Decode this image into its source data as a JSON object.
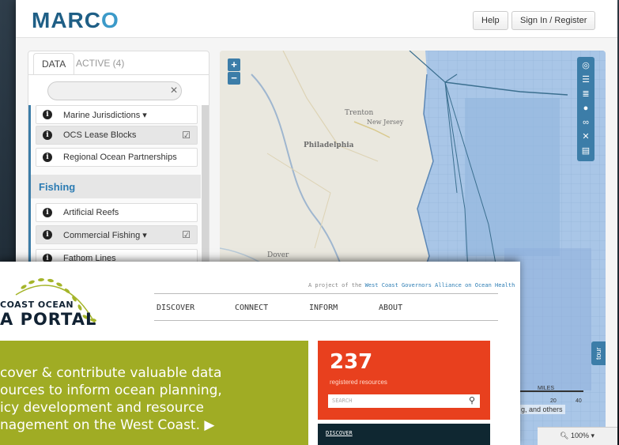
{
  "marco": {
    "logo": "MARC",
    "logo_o": "O",
    "help_label": "Help",
    "signin_label": "Sign In / Register",
    "tabs": [
      "DATA",
      "ACTIVE (4)"
    ],
    "search_clear": "×",
    "layers_top": [
      {
        "label": "Marine Jurisdictions ▾",
        "checked": false
      },
      {
        "label": "OCS Lease Blocks",
        "checked": true
      },
      {
        "label": "Regional Ocean Partnerships",
        "checked": false
      }
    ],
    "section": "Fishing",
    "layers_fishing": [
      {
        "label": "Artificial Reefs",
        "checked": false
      },
      {
        "label": "Commercial Fishing ▾",
        "checked": true
      },
      {
        "label": "Fathom Lines",
        "checked": false
      }
    ],
    "map": {
      "zoom_in": "+",
      "zoom_out": "−",
      "labels": [
        "Trenton",
        "New Jersey",
        "Philadelphia",
        "Dover"
      ],
      "tour_label": "tour",
      "scale_label": "MILES",
      "scale_ticks": [
        "20",
        "40"
      ],
      "attribution": "g, and others",
      "zoom_level": "100%"
    },
    "tool_icons": [
      "globe-icon",
      "list-icon",
      "legend-icon",
      "pin-icon",
      "link-icon",
      "fullscreen-icon",
      "print-icon"
    ]
  },
  "wc": {
    "logo_line1": "COAST OCEAN",
    "logo_line2": "A PORTAL",
    "project_prefix": "A project of the",
    "project_link": "West Coast Governors Alliance on Ocean Health",
    "nav": [
      "DISCOVER",
      "CONNECT",
      "INFORM",
      "ABOUT"
    ],
    "hero_lines": [
      "cover & contribute valuable data",
      "ources to inform ocean planning,",
      "icy development and resource",
      "nagement on the West Coast. ▶"
    ],
    "count": "237",
    "count_sub": "registered resources",
    "search_placeholder": "SEARCH",
    "discover_label": "DISCOVER"
  },
  "colors": {
    "marco_blue": "#3c7da8",
    "hero_green": "#a0ac24",
    "count_red": "#e8401e",
    "dark_teal": "#0f2731"
  }
}
